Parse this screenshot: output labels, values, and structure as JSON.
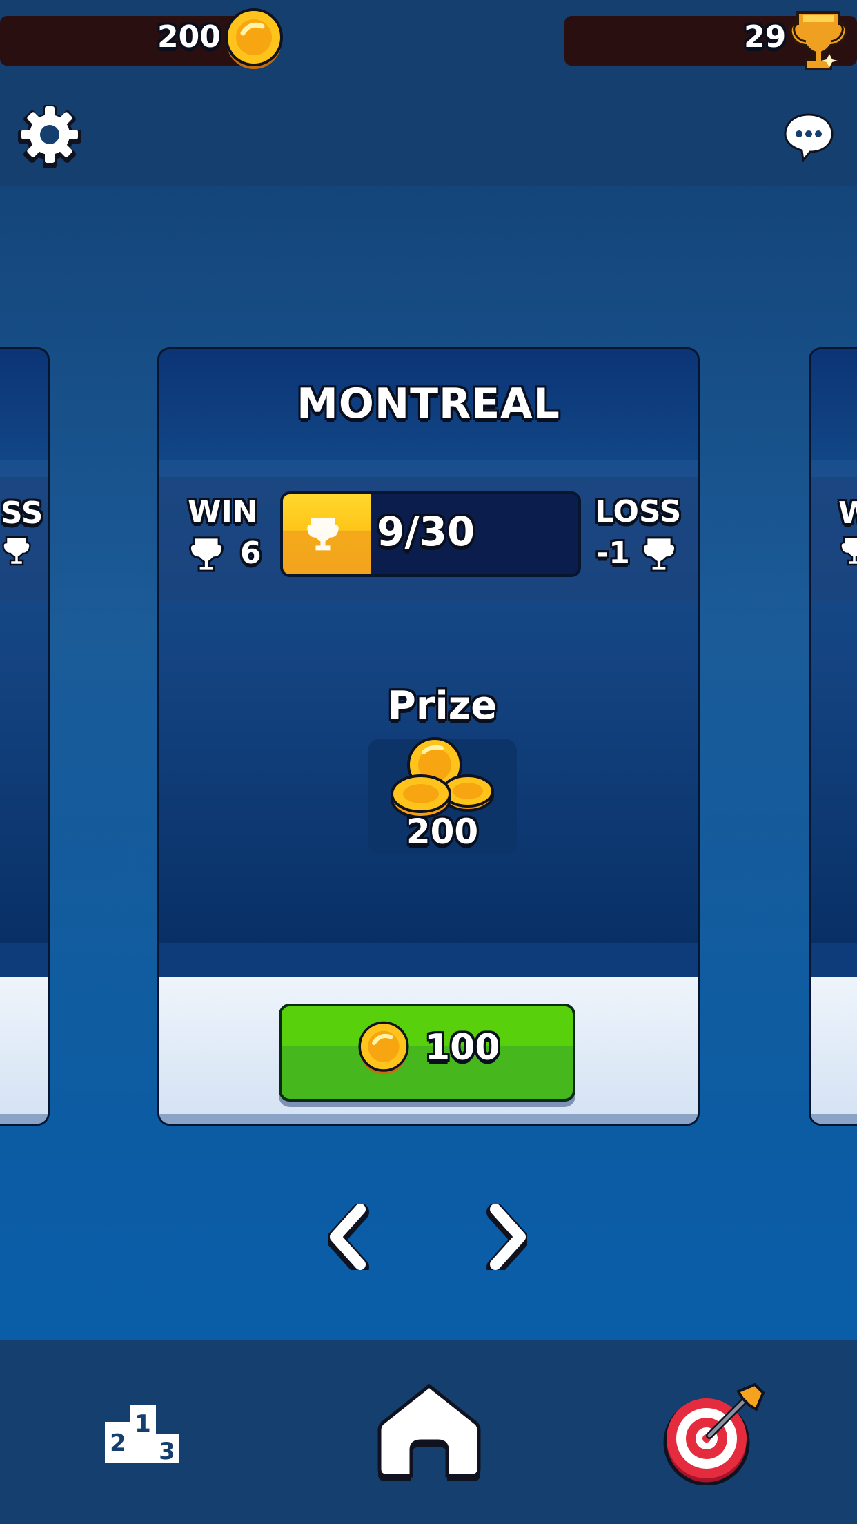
{
  "header": {
    "coins": "200",
    "trophies": "29"
  },
  "card": {
    "city": "MONTREAL",
    "win_label": "WIN",
    "win_value": "6",
    "loss_label": "LOSS",
    "loss_value": "-1",
    "progress_text": "9/30",
    "progress_fraction": 0.3,
    "prize_label": "Prize",
    "prize_value": "200",
    "entry_cost": "100"
  },
  "left_card": {
    "loss_label_partial": "SS"
  },
  "right_card": {
    "win_label_partial": "W"
  },
  "icons": {
    "settings": "gear-icon",
    "chat": "chat-bubble-icon",
    "coin": "coin-icon",
    "trophy": "trophy-icon",
    "leaderboard": "podium-icon",
    "home": "home-icon",
    "target": "target-icon"
  },
  "colors": {
    "gold": "#ffc519",
    "green": "#46b81d",
    "background": "#133e6e"
  }
}
